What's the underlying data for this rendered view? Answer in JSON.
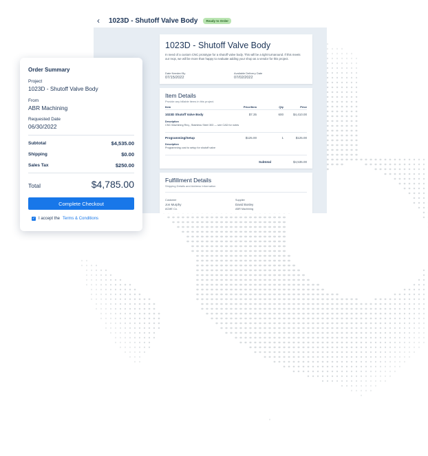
{
  "header": {
    "back_icon": "chevron-left-icon",
    "title": "1023D - Shutoff Valve Body",
    "status_badge": "Ready to Order"
  },
  "quote": {
    "title": "1023D - Shutoff Valve Body",
    "description": "In need of a custom CNC prototype for a shutoff valve body. This will be a tight turnaround. If this meets our reqs, we will be more than happy to evaluate adding your shop as a vendor for this project.",
    "date_needed_label": "Date Needed By",
    "date_needed": "07/15/2022",
    "delivery_label": "Available Delivery Date",
    "delivery": "07/02/2022"
  },
  "item_details": {
    "title": "Item Details",
    "subtitle": "Provide any billable items in this project.",
    "columns": [
      "Item",
      "Price/Item",
      "Qty",
      "Price"
    ],
    "items": [
      {
        "name": "1023D Shutoff Valve Body",
        "price_item": "$7.35",
        "qty": "600",
        "price": "$4,410.00",
        "desc_label": "Description",
        "desc": "CNC Machining Req., Stainless Steel 303 — see CAD for notes"
      },
      {
        "name": "Programming/Setup",
        "price_item": "$125.00",
        "qty": "1",
        "price": "$125.00",
        "desc_label": "Description",
        "desc": "Programming cost to setup for shutoff valve"
      }
    ],
    "subtotal_label": "Subtotal",
    "subtotal": "$4,535.00"
  },
  "fulfillment": {
    "title": "Fulfillment Details",
    "subtitle": "Shipping Details and Address Information",
    "customer_label": "Customer",
    "customer_name": "Jon Murphy",
    "customer_company": "ACME Co.",
    "supplier_label": "Supplier",
    "supplier_name": "David Bosley",
    "supplier_company": "ABR Machining"
  },
  "summary": {
    "title": "Order Summary",
    "project_label": "Project",
    "project": "1023D - Shutoff Valve Body",
    "from_label": "From",
    "from": "ABR Machining",
    "requested_label": "Requested Date",
    "requested": "06/30/2022",
    "subtotal_label": "Subtotal",
    "subtotal": "$4,535.00",
    "shipping_label": "Shipping",
    "shipping": "$0.00",
    "tax_label": "Sales Tax",
    "tax": "$250.00",
    "total_label": "Total",
    "total": "$4,785.00",
    "checkout_label": "Complete Checkout",
    "terms_prefix": "I accept the",
    "terms_link": "Terms & Conditions",
    "terms_checked": true
  },
  "colors": {
    "navy_text": "#1d3557",
    "accent_blue": "#1877e9",
    "panel_bg": "#e7edf3",
    "badge_green": "#b9e4b1",
    "globe_dot": "#d8dcdf"
  },
  "decor": {
    "background": "dotted-globe-map"
  }
}
